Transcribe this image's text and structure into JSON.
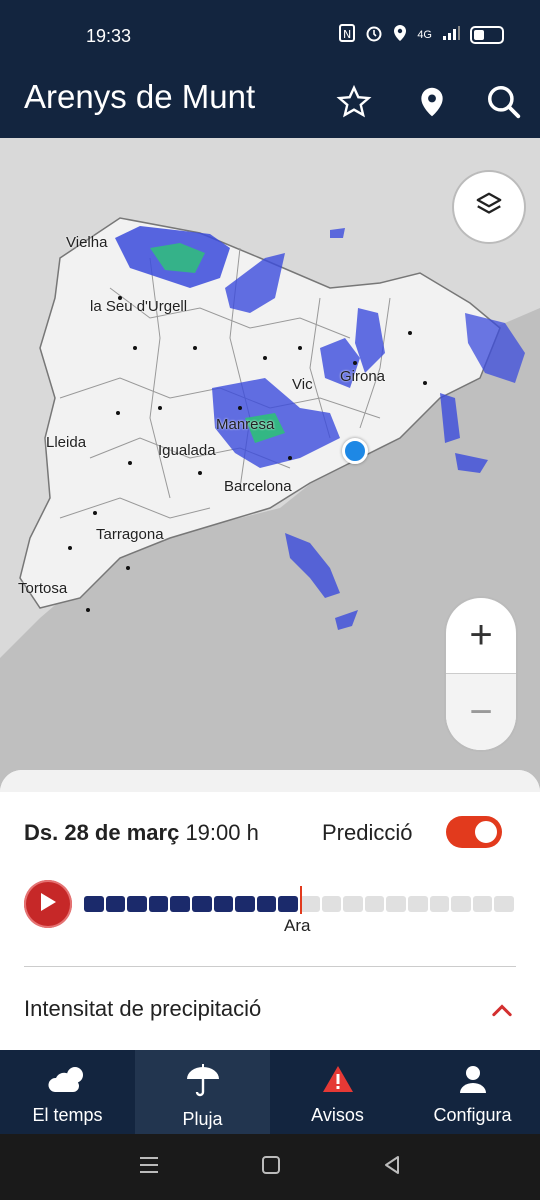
{
  "status": {
    "time": "19:33",
    "network": "4G",
    "icons": [
      "nfc-icon",
      "alarm-icon",
      "location-icon",
      "signal-icon",
      "battery-icon"
    ]
  },
  "appbar": {
    "title": "Arenys de Munt",
    "icons": [
      "star-icon",
      "location-pin-icon",
      "search-icon"
    ]
  },
  "map": {
    "cities": [
      "Vielha",
      "la Seu d'Urgell",
      "Vic",
      "Girona",
      "Manresa",
      "Lleida",
      "Igualada",
      "Barcelona",
      "Tarragona",
      "Tortosa"
    ],
    "layers_icon": "layers-icon",
    "zoom_in": "+",
    "zoom_out": "−"
  },
  "sheet": {
    "date_bold": "Ds. 28 de març",
    "time": "19:00 h",
    "prediction_label": "Predicció",
    "prediction_enabled": true,
    "timeline": {
      "now_label": "Ara",
      "segments_total": 20,
      "segments_past": 10,
      "past_color": "#1b2a6b",
      "future_color": "#e0e0e0"
    },
    "section_title": "Intensitat de precipitació"
  },
  "nav": {
    "items": [
      {
        "label": "El temps",
        "icon": "cloud-icon"
      },
      {
        "label": "Pluja",
        "icon": "umbrella-icon"
      },
      {
        "label": "Avisos",
        "icon": "warning-icon"
      },
      {
        "label": "Configura",
        "icon": "user-icon"
      }
    ],
    "active_index": 1
  },
  "colors": {
    "appbar": "#13253f",
    "accent": "#e23a1d"
  }
}
